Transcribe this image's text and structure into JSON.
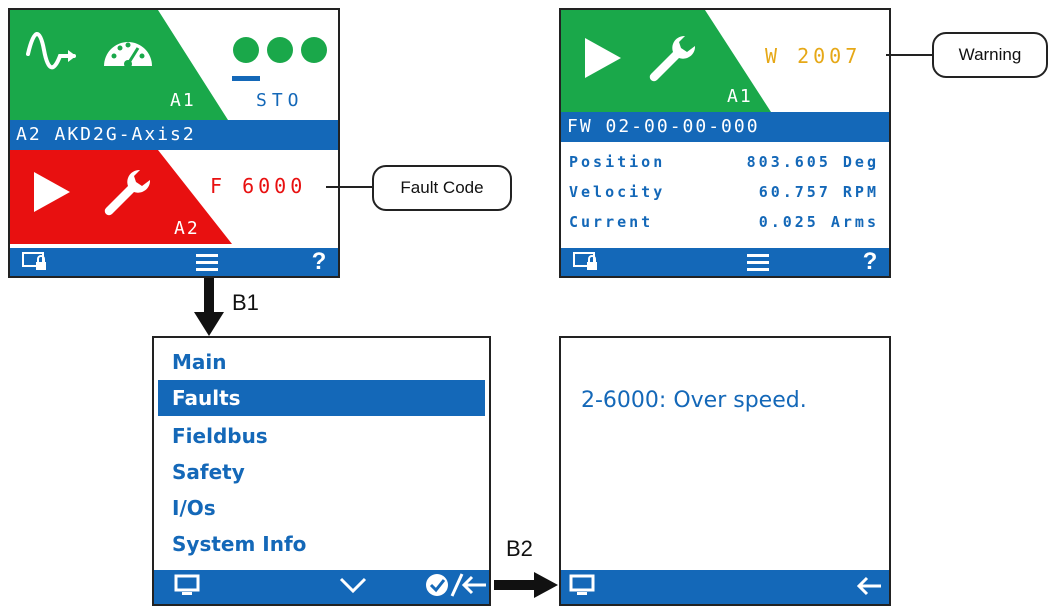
{
  "screen1": {
    "axis1": {
      "label": "A1",
      "status": "STO"
    },
    "axis_bar": "A2 AKD2G-Axis2",
    "axis2": {
      "label": "A2",
      "fault": "F 6000"
    },
    "footer": {
      "left_icon": "monitor-lock-icon",
      "center_icon": "menu-icon",
      "right_label": "?"
    }
  },
  "screen2": {
    "axis1": {
      "label": "A1",
      "warning": "W 2007"
    },
    "firmware": "FW 02-00-00-000",
    "rows": [
      {
        "name": "Position",
        "value": "803.605 Deg"
      },
      {
        "name": "Velocity",
        "value": "60.757 RPM"
      },
      {
        "name": "Current",
        "value": "0.025 Arms"
      }
    ],
    "footer": {
      "right_label": "?"
    }
  },
  "callouts": {
    "fault_code": "Fault Code",
    "warning": "Warning"
  },
  "arrows": {
    "b1": "B1",
    "b2": "B2"
  },
  "menu": {
    "items": [
      "Main",
      "Faults",
      "Fieldbus",
      "Safety",
      "I/Os",
      "System Info"
    ],
    "selected": "Faults"
  },
  "fault_screen": {
    "message": "2-6000: Over speed."
  },
  "colors": {
    "green": "#1aa84a",
    "red": "#e81010",
    "blue": "#1468b8",
    "warning": "#e6a817"
  }
}
